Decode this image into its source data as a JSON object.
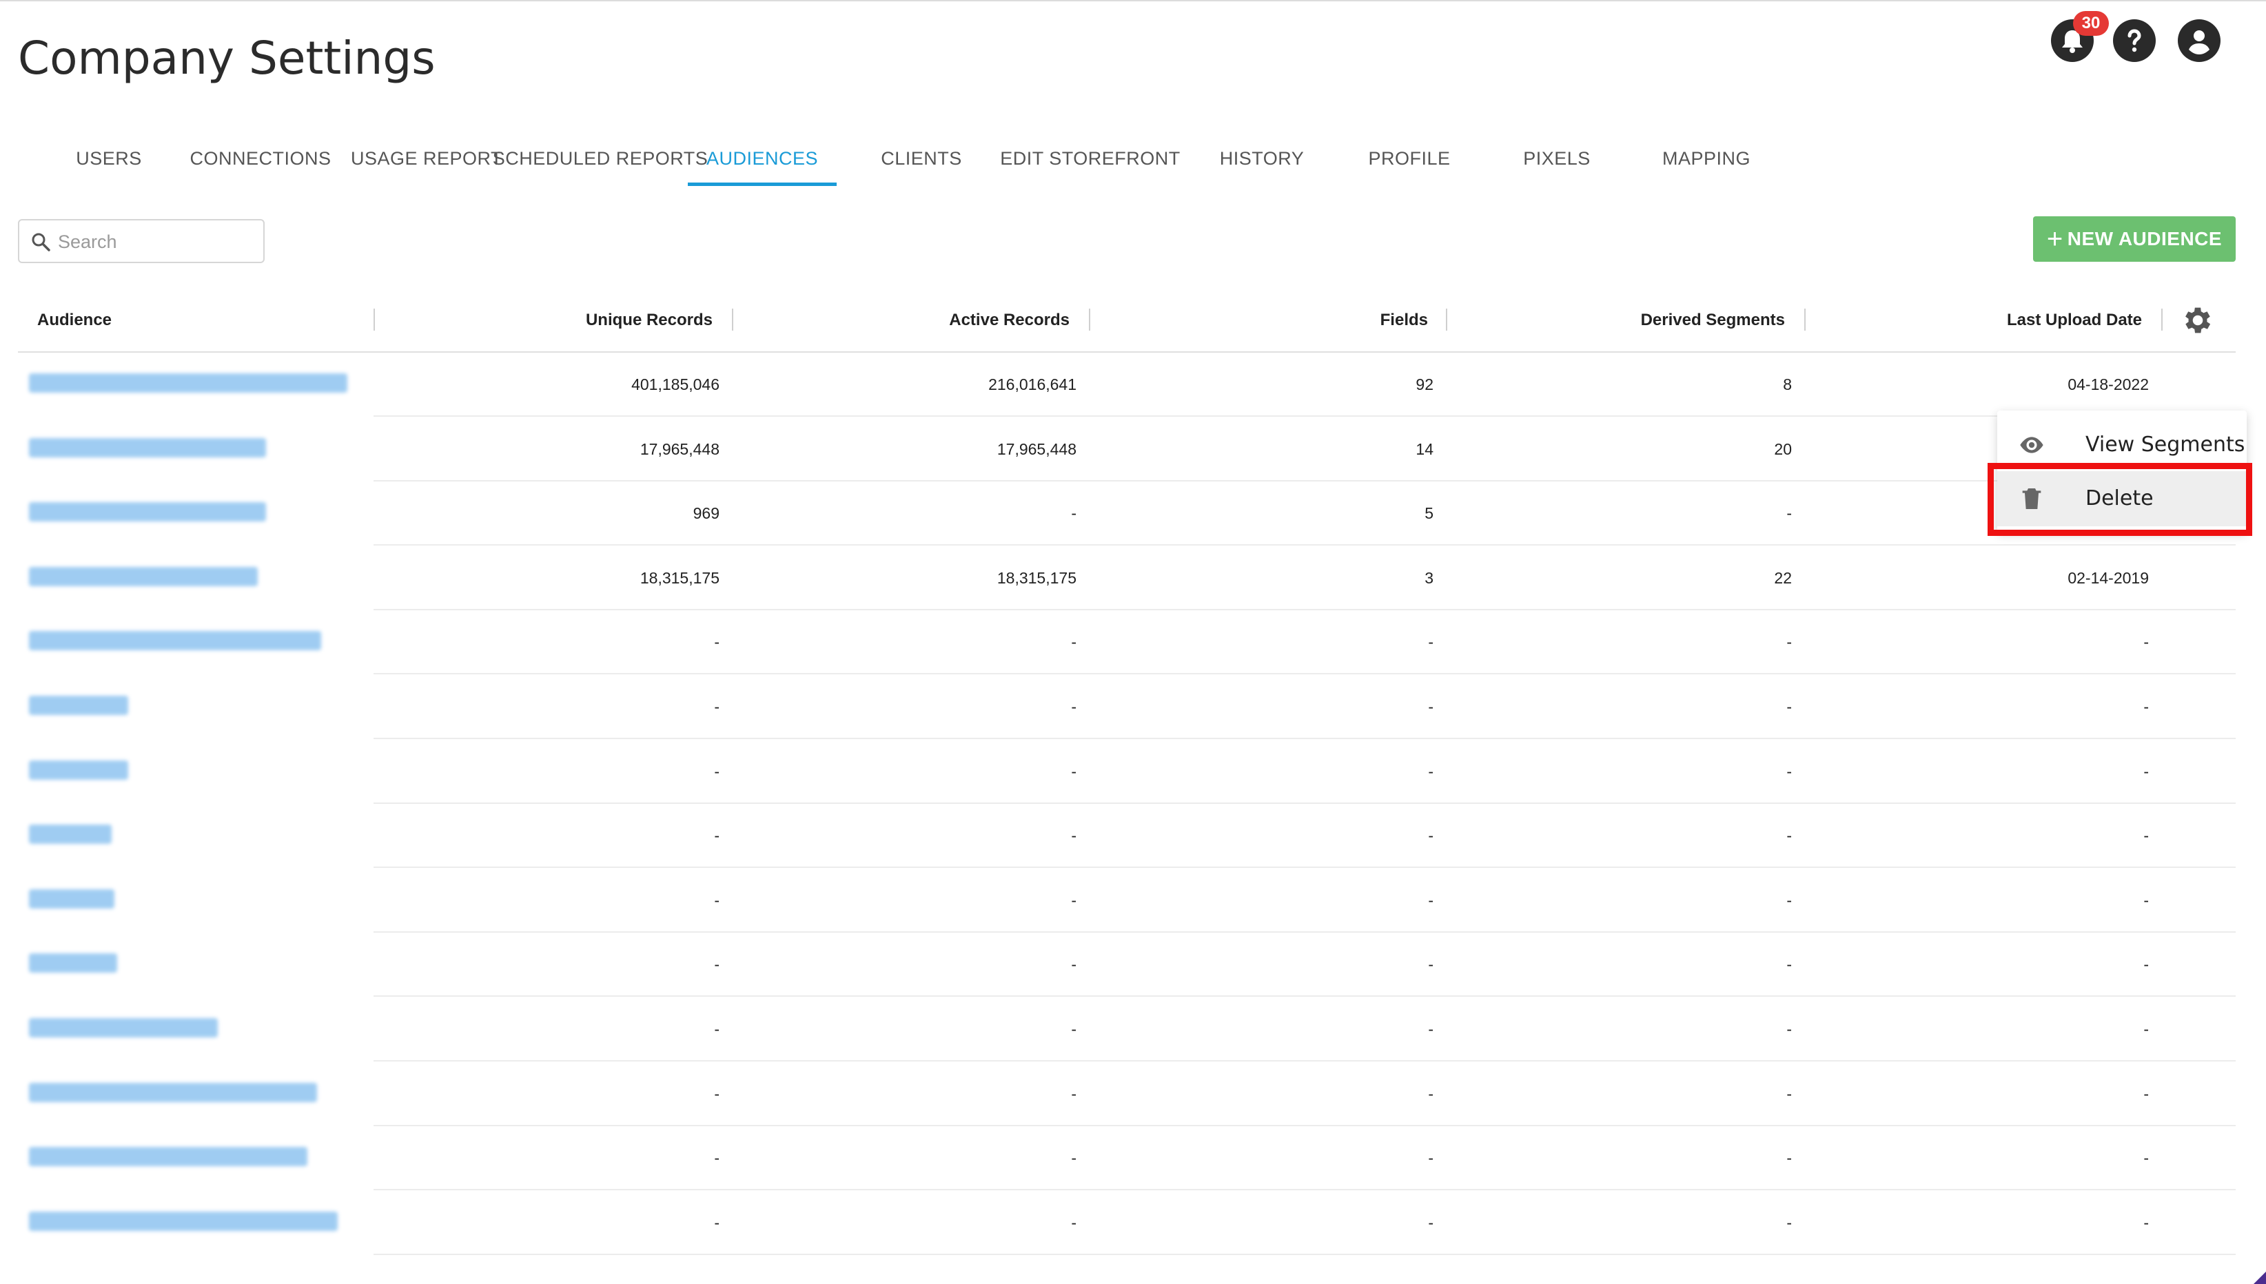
{
  "page": {
    "title": "Company Settings"
  },
  "header": {
    "notifications": {
      "icon": "bell-icon",
      "count": "30"
    },
    "help": {
      "icon": "help-icon"
    },
    "account": {
      "icon": "account-icon"
    }
  },
  "tabs": [
    {
      "label": "USERS",
      "active": false
    },
    {
      "label": "CONNECTIONS",
      "active": false
    },
    {
      "label": "USAGE REPORT",
      "active": false
    },
    {
      "label": "SCHEDULED REPORTS",
      "active": false
    },
    {
      "label": "AUDIENCES",
      "active": true
    },
    {
      "label": "CLIENTS",
      "active": false
    },
    {
      "label": "EDIT STOREFRONT",
      "active": false
    },
    {
      "label": "HISTORY",
      "active": false
    },
    {
      "label": "PROFILE",
      "active": false
    },
    {
      "label": "PIXELS",
      "active": false
    },
    {
      "label": "MAPPING",
      "active": false
    }
  ],
  "search": {
    "placeholder": "Search",
    "value": ""
  },
  "actions": {
    "new_audience_label": "NEW AUDIENCE",
    "accent": "#6cc070"
  },
  "table": {
    "columns": {
      "audience": "Audience",
      "unique_records": "Unique Records",
      "active_records": "Active Records",
      "fields": "Fields",
      "derived_segments": "Derived Segments",
      "last_upload_date": "Last Upload Date"
    },
    "rows": [
      {
        "unique": "401,185,046",
        "active": "216,016,641",
        "fields": "92",
        "derived": "8",
        "date": "04-18-2022"
      },
      {
        "unique": "17,965,448",
        "active": "17,965,448",
        "fields": "14",
        "derived": "20",
        "date": ""
      },
      {
        "unique": "969",
        "active": "-",
        "fields": "5",
        "derived": "-",
        "date": ""
      },
      {
        "unique": "18,315,175",
        "active": "18,315,175",
        "fields": "3",
        "derived": "22",
        "date": "02-14-2019"
      },
      {
        "unique": "-",
        "active": "-",
        "fields": "-",
        "derived": "-",
        "date": "-"
      },
      {
        "unique": "-",
        "active": "-",
        "fields": "-",
        "derived": "-",
        "date": "-"
      },
      {
        "unique": "-",
        "active": "-",
        "fields": "-",
        "derived": "-",
        "date": "-"
      },
      {
        "unique": "-",
        "active": "-",
        "fields": "-",
        "derived": "-",
        "date": "-"
      },
      {
        "unique": "-",
        "active": "-",
        "fields": "-",
        "derived": "-",
        "date": "-"
      },
      {
        "unique": "-",
        "active": "-",
        "fields": "-",
        "derived": "-",
        "date": "-"
      },
      {
        "unique": "-",
        "active": "-",
        "fields": "-",
        "derived": "-",
        "date": "-"
      },
      {
        "unique": "-",
        "active": "-",
        "fields": "-",
        "derived": "-",
        "date": "-"
      },
      {
        "unique": "-",
        "active": "-",
        "fields": "-",
        "derived": "-",
        "date": "-"
      },
      {
        "unique": "-",
        "active": "-",
        "fields": "-",
        "derived": "-",
        "date": "-"
      }
    ]
  },
  "context_menu": {
    "items": [
      {
        "icon": "eye-icon",
        "label": "View Segments"
      },
      {
        "icon": "trash-icon",
        "label": "Delete"
      }
    ],
    "highlight_color": "#ee1111"
  }
}
